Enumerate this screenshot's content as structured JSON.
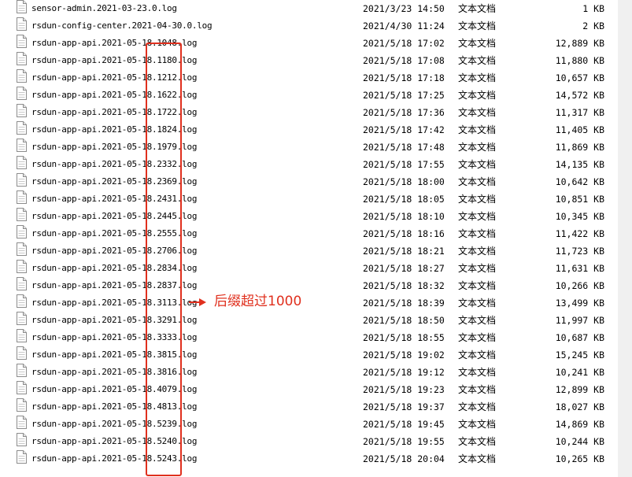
{
  "files": [
    {
      "name": "sensor-admin.2021-03-23.0.log",
      "date": "2021/3/23 14:50",
      "type": "文本文档",
      "size": "1 KB"
    },
    {
      "name": "rsdun-config-center.2021-04-30.0.log",
      "date": "2021/4/30 11:24",
      "type": "文本文档",
      "size": "2 KB"
    },
    {
      "name": "rsdun-app-api.2021-05-18.1048.log",
      "date": "2021/5/18 17:02",
      "type": "文本文档",
      "size": "12,889 KB"
    },
    {
      "name": "rsdun-app-api.2021-05-18.1180.log",
      "date": "2021/5/18 17:08",
      "type": "文本文档",
      "size": "11,880 KB"
    },
    {
      "name": "rsdun-app-api.2021-05-18.1212.log",
      "date": "2021/5/18 17:18",
      "type": "文本文档",
      "size": "10,657 KB"
    },
    {
      "name": "rsdun-app-api.2021-05-18.1622.log",
      "date": "2021/5/18 17:25",
      "type": "文本文档",
      "size": "14,572 KB"
    },
    {
      "name": "rsdun-app-api.2021-05-18.1722.log",
      "date": "2021/5/18 17:36",
      "type": "文本文档",
      "size": "11,317 KB"
    },
    {
      "name": "rsdun-app-api.2021-05-18.1824.log",
      "date": "2021/5/18 17:42",
      "type": "文本文档",
      "size": "11,405 KB"
    },
    {
      "name": "rsdun-app-api.2021-05-18.1979.log",
      "date": "2021/5/18 17:48",
      "type": "文本文档",
      "size": "11,869 KB"
    },
    {
      "name": "rsdun-app-api.2021-05-18.2332.log",
      "date": "2021/5/18 17:55",
      "type": "文本文档",
      "size": "14,135 KB"
    },
    {
      "name": "rsdun-app-api.2021-05-18.2369.log",
      "date": "2021/5/18 18:00",
      "type": "文本文档",
      "size": "10,642 KB"
    },
    {
      "name": "rsdun-app-api.2021-05-18.2431.log",
      "date": "2021/5/18 18:05",
      "type": "文本文档",
      "size": "10,851 KB"
    },
    {
      "name": "rsdun-app-api.2021-05-18.2445.log",
      "date": "2021/5/18 18:10",
      "type": "文本文档",
      "size": "10,345 KB"
    },
    {
      "name": "rsdun-app-api.2021-05-18.2555.log",
      "date": "2021/5/18 18:16",
      "type": "文本文档",
      "size": "11,422 KB"
    },
    {
      "name": "rsdun-app-api.2021-05-18.2706.log",
      "date": "2021/5/18 18:21",
      "type": "文本文档",
      "size": "11,723 KB"
    },
    {
      "name": "rsdun-app-api.2021-05-18.2834.log",
      "date": "2021/5/18 18:27",
      "type": "文本文档",
      "size": "11,631 KB"
    },
    {
      "name": "rsdun-app-api.2021-05-18.2837.log",
      "date": "2021/5/18 18:32",
      "type": "文本文档",
      "size": "10,266 KB"
    },
    {
      "name": "rsdun-app-api.2021-05-18.3113.log",
      "date": "2021/5/18 18:39",
      "type": "文本文档",
      "size": "13,499 KB"
    },
    {
      "name": "rsdun-app-api.2021-05-18.3291.log",
      "date": "2021/5/18 18:50",
      "type": "文本文档",
      "size": "11,997 KB"
    },
    {
      "name": "rsdun-app-api.2021-05-18.3333.log",
      "date": "2021/5/18 18:55",
      "type": "文本文档",
      "size": "10,687 KB"
    },
    {
      "name": "rsdun-app-api.2021-05-18.3815.log",
      "date": "2021/5/18 19:02",
      "type": "文本文档",
      "size": "15,245 KB"
    },
    {
      "name": "rsdun-app-api.2021-05-18.3816.log",
      "date": "2021/5/18 19:12",
      "type": "文本文档",
      "size": "10,241 KB"
    },
    {
      "name": "rsdun-app-api.2021-05-18.4079.log",
      "date": "2021/5/18 19:23",
      "type": "文本文档",
      "size": "12,899 KB"
    },
    {
      "name": "rsdun-app-api.2021-05-18.4813.log",
      "date": "2021/5/18 19:37",
      "type": "文本文档",
      "size": "18,027 KB"
    },
    {
      "name": "rsdun-app-api.2021-05-18.5239.log",
      "date": "2021/5/18 19:45",
      "type": "文本文档",
      "size": "14,869 KB"
    },
    {
      "name": "rsdun-app-api.2021-05-18.5240.log",
      "date": "2021/5/18 19:55",
      "type": "文本文档",
      "size": "10,244 KB"
    },
    {
      "name": "rsdun-app-api.2021-05-18.5243.log",
      "date": "2021/5/18 20:04",
      "type": "文本文档",
      "size": "10,265 KB"
    }
  ],
  "annotation": {
    "text": "后缀超过1000",
    "color": "#e0301e"
  },
  "icons": {
    "file": "text-document-icon",
    "arrow": "right-arrow-icon"
  }
}
